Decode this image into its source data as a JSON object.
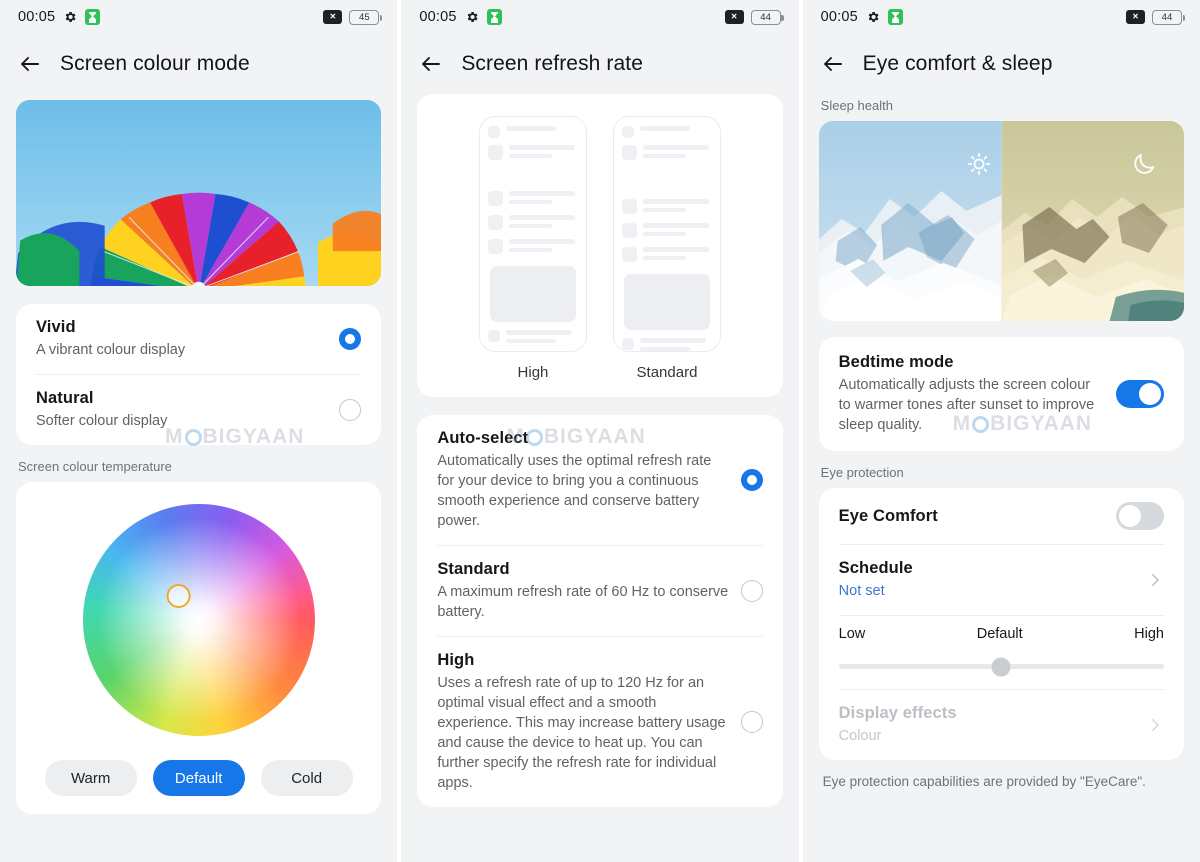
{
  "watermark": {
    "text_before": "M",
    "text_after": "BIGYAAN"
  },
  "screens": [
    {
      "id": "screen-colour-mode",
      "statusbar": {
        "time": "00:05",
        "gear_icon": "gear-icon",
        "app_icon": "green-app-icon",
        "cast_icon": "x-badge-icon",
        "battery": "45"
      },
      "appbar": {
        "back": "back-arrow-icon",
        "title": "Screen colour mode"
      },
      "hero": {
        "name": "parachute-photo",
        "alt": "Colourful parachute against blue sky"
      },
      "modes": [
        {
          "title": "Vivid",
          "sub": "A vibrant colour display",
          "selected": true
        },
        {
          "title": "Natural",
          "sub": "Softer colour display",
          "selected": false
        }
      ],
      "temperature": {
        "group_label": "Screen colour temperature",
        "wheel": "colour-wheel",
        "buttons": [
          {
            "label": "Warm",
            "active": false
          },
          {
            "label": "Default",
            "active": true
          },
          {
            "label": "Cold",
            "active": false
          }
        ]
      }
    },
    {
      "id": "screen-refresh-rate",
      "statusbar": {
        "time": "00:05",
        "gear_icon": "gear-icon",
        "app_icon": "green-app-icon",
        "cast_icon": "x-badge-icon",
        "battery": "44"
      },
      "appbar": {
        "back": "back-arrow-icon",
        "title": "Screen refresh rate"
      },
      "preview": {
        "labels": [
          "High",
          "Standard"
        ]
      },
      "options": [
        {
          "title": "Auto-select",
          "sub": "Automatically uses the optimal refresh rate for your device to bring you a continuous smooth experience and conserve battery power.",
          "selected": true
        },
        {
          "title": "Standard",
          "sub": "A maximum refresh rate of 60 Hz to conserve battery.",
          "selected": false
        },
        {
          "title": "High",
          "sub": "Uses a refresh rate of up to 120 Hz for an optimal visual effect and a smooth experience. This may increase battery usage and cause the device to heat up. You can further specify the refresh rate for individual apps.",
          "selected": false
        }
      ]
    },
    {
      "id": "eye-comfort-and-sleep",
      "statusbar": {
        "time": "00:05",
        "gear_icon": "gear-icon",
        "app_icon": "green-app-icon",
        "cast_icon": "x-badge-icon",
        "battery": "44"
      },
      "appbar": {
        "back": "back-arrow-icon",
        "title": "Eye comfort & sleep"
      },
      "sleep_health": {
        "group_label": "Sleep health",
        "image": "split-mountain-day-night-photo",
        "sun_icon": "sun-icon",
        "moon_icon": "moon-icon"
      },
      "bedtime": {
        "title": "Bedtime mode",
        "sub": "Automatically adjusts the screen colour to warmer tones after sunset to improve sleep quality.",
        "enabled": true
      },
      "eye_protection": {
        "group_label": "Eye protection",
        "eye_comfort": {
          "title": "Eye Comfort",
          "enabled": false
        },
        "schedule": {
          "title": "Schedule",
          "value": "Not set"
        },
        "slider": {
          "low": "Low",
          "default": "Default",
          "high": "High",
          "position_percent": 50
        },
        "display_effects": {
          "title": "Display effects",
          "value": "Colour",
          "disabled": true
        }
      },
      "footnote": "Eye protection capabilities are provided by \"EyeCare\"."
    }
  ],
  "colors": {
    "accent": "#1777e8",
    "page_bg": "#f2f3f5",
    "card_bg": "#ffffff",
    "link": "#3f77cf",
    "status_green": "#2ec258"
  }
}
